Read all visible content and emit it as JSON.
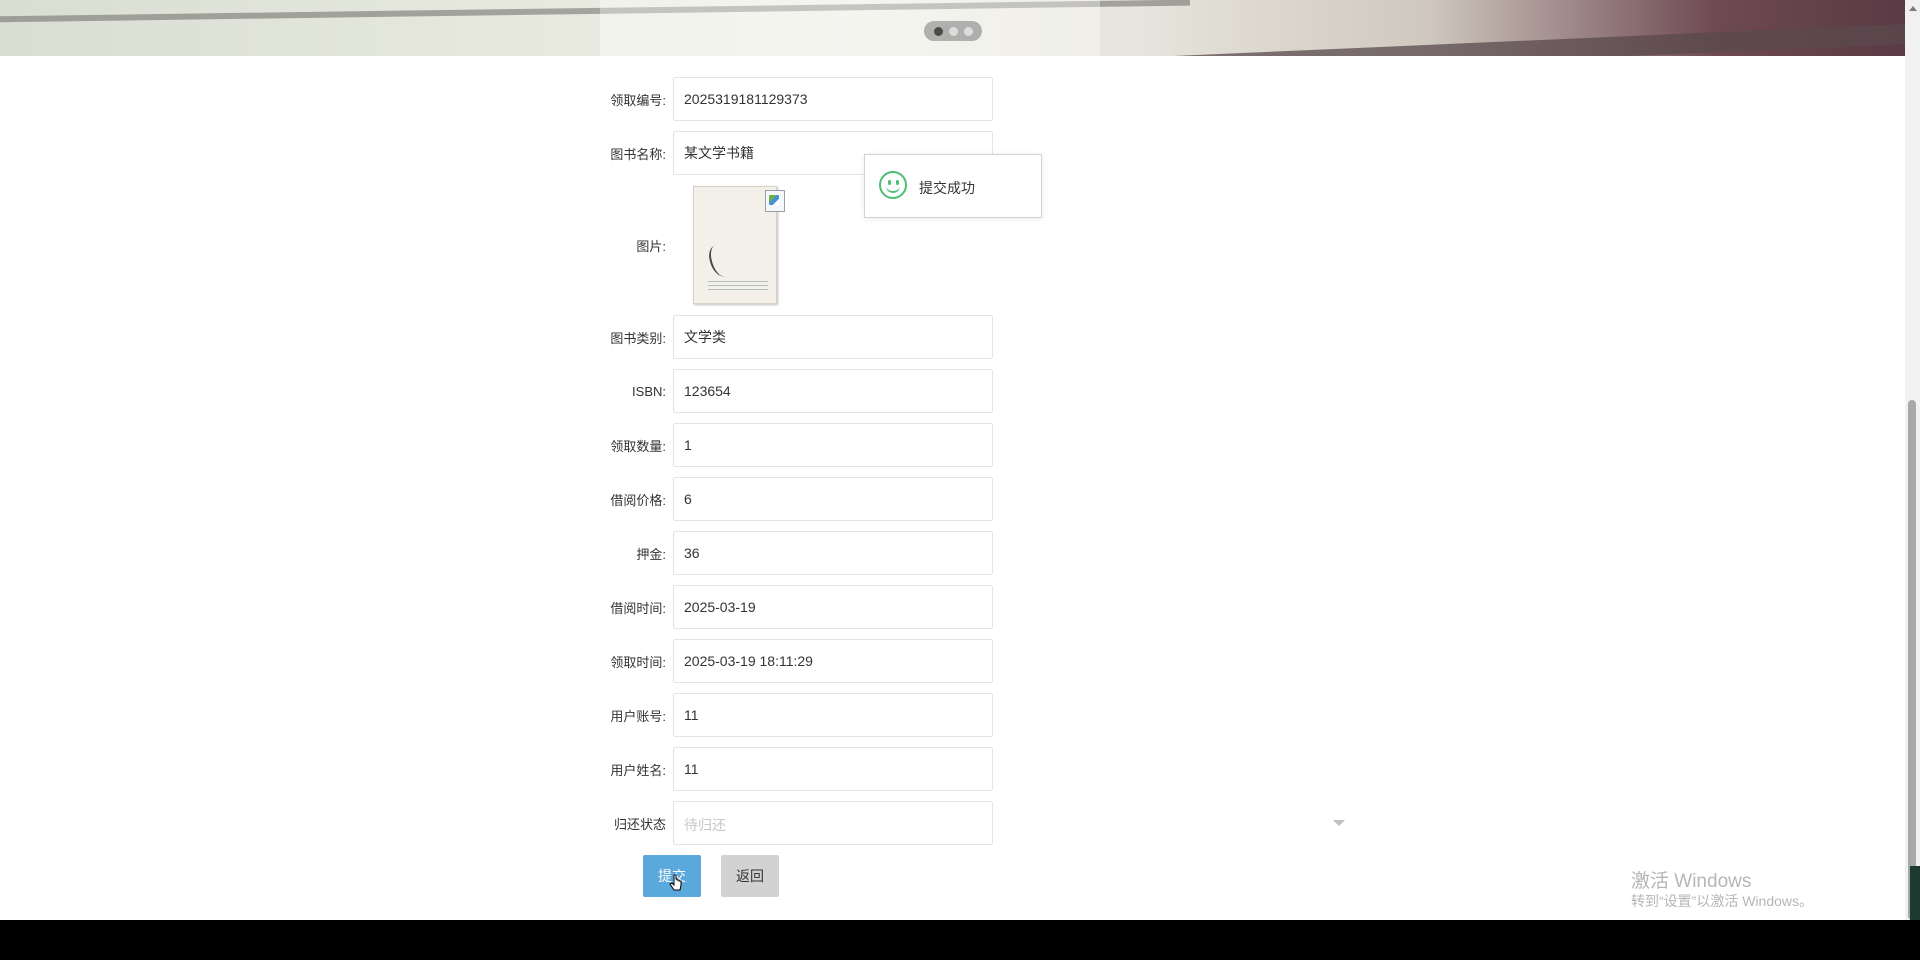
{
  "form": {
    "fields": [
      {
        "key": "receive_no",
        "label": "领取编号:",
        "value": "2025319181129373"
      },
      {
        "key": "book_name",
        "label": "图书名称:",
        "value": "某文学书籍"
      },
      {
        "key": "image",
        "label": "图片:"
      },
      {
        "key": "category",
        "label": "图书类别:",
        "value": "文学类"
      },
      {
        "key": "isbn",
        "label": "ISBN:",
        "value": "123654"
      },
      {
        "key": "quantity",
        "label": "领取数量:",
        "value": "1"
      },
      {
        "key": "price",
        "label": "借阅价格:",
        "value": "6"
      },
      {
        "key": "deposit",
        "label": "押金:",
        "value": "36"
      },
      {
        "key": "borrow_time",
        "label": "借阅时间:",
        "value": "2025-03-19"
      },
      {
        "key": "receive_time",
        "label": "领取时间:",
        "value": "2025-03-19 18:11:29"
      },
      {
        "key": "user_account",
        "label": "用户账号:",
        "value": "11"
      },
      {
        "key": "user_name",
        "label": "用户姓名:",
        "value": "11"
      }
    ],
    "return_status": {
      "label": "归还状态",
      "placeholder": "待归还"
    }
  },
  "buttons": {
    "submit": "提交",
    "back": "返回"
  },
  "toast": {
    "message": "提交成功",
    "icon": "smile-icon"
  },
  "carousel": {
    "dots": 3,
    "active": 1
  },
  "watermark": {
    "line1": "激活 Windows",
    "line2": "转到“设置”以激活 Windows。"
  },
  "colors": {
    "submit_bg": "#5ba8dc",
    "back_bg": "#d2d2d2",
    "success": "#4bbf73"
  }
}
